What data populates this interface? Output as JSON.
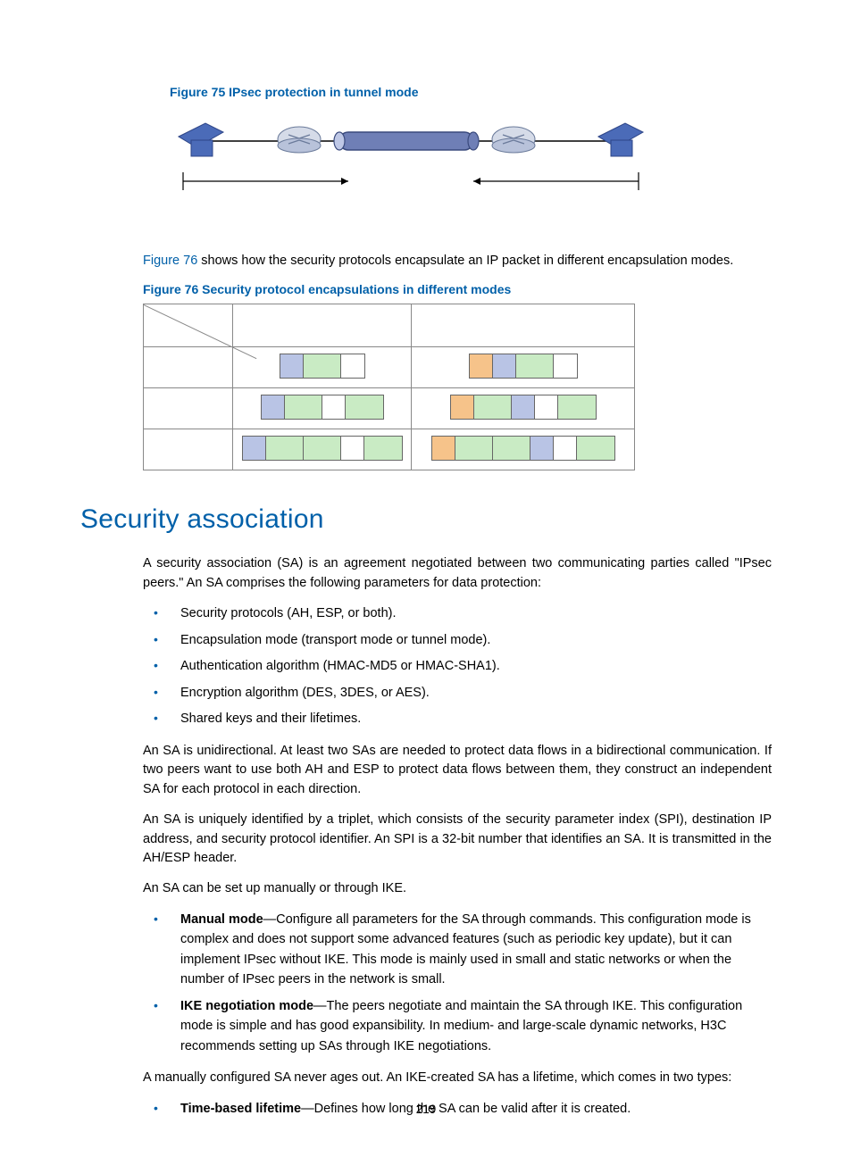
{
  "figure75_caption": "Figure 75 IPsec protection in tunnel mode",
  "intro_link": "Figure 76",
  "intro_rest": " shows how the security protocols encapsulate an IP packet in different encapsulation modes.",
  "figure76_caption": "Figure 76 Security protocol encapsulations in different modes",
  "section_title": "Security association",
  "sa_para1": "A security association (SA) is an agreement negotiated between two communicating parties called \"IPsec peers.\" An SA comprises the following parameters for data protection:",
  "sa_bullets": [
    "Security protocols (AH, ESP, or both).",
    "Encapsulation mode (transport mode or tunnel mode).",
    "Authentication algorithm (HMAC-MD5 or HMAC-SHA1).",
    "Encryption algorithm (DES, 3DES, or AES).",
    "Shared keys and their lifetimes."
  ],
  "sa_para2": "An SA is unidirectional. At least two SAs are needed to protect data flows in a bidirectional communication. If two peers want to use both AH and ESP to protect data flows between them, they construct an independent SA for each protocol in each direction.",
  "sa_para3": "An SA is uniquely identified by a triplet, which consists of the security parameter index (SPI), destination IP address, and security protocol identifier. An SPI is a 32-bit number that identifies an SA. It is transmitted in the AH/ESP header.",
  "sa_para4": "An SA can be set up manually or through IKE.",
  "modes": {
    "manual_label": "Manual mode",
    "manual_text": "—Configure all parameters for the SA through commands. This configuration mode is complex and does not support some advanced features (such as periodic key update), but it can implement IPsec without IKE. This mode is mainly used in small and static networks or when the number of IPsec peers in the network is small.",
    "ike_label": "IKE negotiation mode",
    "ike_text": "—The peers negotiate and maintain the SA through IKE. This configuration mode is simple and has good expansibility. In medium- and large-scale dynamic networks, H3C recommends setting up SAs through IKE negotiations."
  },
  "sa_para5": "A manually configured SA never ages out. An IKE-created SA has a lifetime, which comes in two types:",
  "lifetime": {
    "time_label": "Time-based lifetime",
    "time_text": "—Defines how long the SA can be valid after it is created."
  },
  "page_number": "219"
}
